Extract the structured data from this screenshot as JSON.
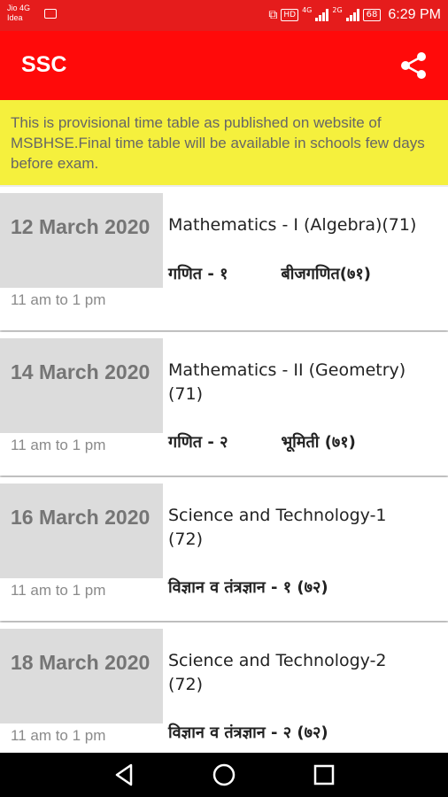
{
  "status_bar": {
    "carrier_line1": "Jio 4G",
    "carrier_line2": "Idea",
    "hd_label": "HD",
    "net1_label": "4G",
    "net2_label": "2G",
    "battery_level": "68",
    "time": "6:29 PM",
    "icons": [
      "image-icon",
      "hotspot-icon",
      "signal-icon",
      "battery-icon"
    ]
  },
  "app_bar": {
    "title": "SSC",
    "share_icon": "share-icon"
  },
  "notice": {
    "text": "This is provisional time table as published on website of MSBHSE.Final time table will be available in schools few days before exam."
  },
  "exams": [
    {
      "date": "12 March 2020",
      "time": "11 am to 1 pm",
      "subject_en": "Mathematics - I (Algebra)(71)",
      "subject_mr_1": "गणित - १",
      "subject_mr_2": "बीजगणित(७१)"
    },
    {
      "date": "14 March 2020",
      "time": "11 am to 1 pm",
      "subject_en": "Mathematics - II (Geometry)(71)",
      "subject_mr_1": "गणित - २",
      "subject_mr_2": "भूमिती (७१)"
    },
    {
      "date": "16 March 2020",
      "time": "11 am to 1 pm",
      "subject_en": "Science and Technology-1 (72)",
      "subject_mr_1": "विज्ञान व तंत्रज्ञान - १ (७२)",
      "subject_mr_2": ""
    },
    {
      "date": "18 March 2020",
      "time": "11 am to 1 pm",
      "subject_en": "Science and Technology-2 (72)",
      "subject_mr_1": "विज्ञान व तंत्रज्ञान - २ (७२)",
      "subject_mr_2": ""
    }
  ],
  "nav_bar": {
    "icons": [
      "back-icon",
      "home-icon",
      "recents-icon"
    ]
  },
  "colors": {
    "status_bar": "#e51c1c",
    "app_bar": "#ff0a0a",
    "notice_bg": "#f5f03d",
    "date_box": "#dcdcdc"
  }
}
